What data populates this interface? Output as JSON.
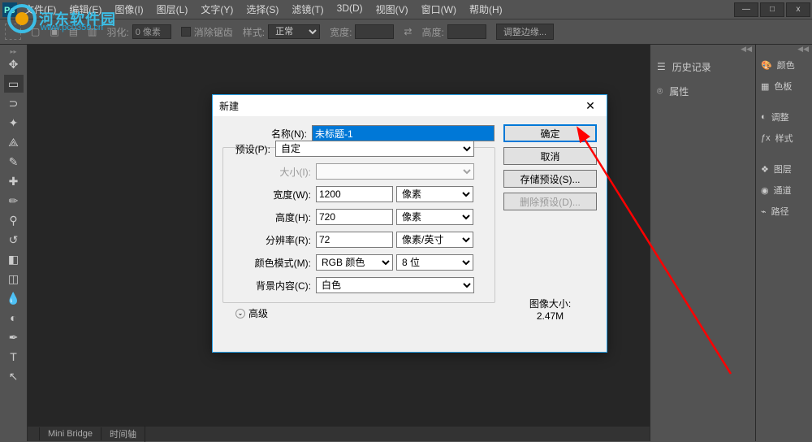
{
  "menubar": {
    "items": [
      "文件(F)",
      "编辑(E)",
      "图像(I)",
      "图层(L)",
      "文字(Y)",
      "选择(S)",
      "滤镜(T)",
      "3D(D)",
      "视图(V)",
      "窗口(W)",
      "帮助(H)"
    ]
  },
  "win_controls": {
    "min": "—",
    "max": "□",
    "close": "x"
  },
  "optbar": {
    "feather_label": "羽化:",
    "feather_value": "0 像素",
    "antialias": "消除锯齿",
    "style_label": "样式:",
    "style_value": "正常",
    "width_label": "宽度:",
    "height_label": "高度:",
    "refine": "调整边缘..."
  },
  "panels": {
    "history": "历史记录",
    "properties": "属性"
  },
  "side_panels": [
    "颜色",
    "色板",
    "调整",
    "样式",
    "图层",
    "通道",
    "路径"
  ],
  "bottom_tabs": [
    "Mini Bridge",
    "时间轴"
  ],
  "dialog": {
    "title": "新建",
    "name_label": "名称(N):",
    "name_value": "未标题-1",
    "preset_label": "预设(P):",
    "preset_value": "自定",
    "size_label": "大小(I):",
    "width_label": "宽度(W):",
    "width_value": "1200",
    "width_unit": "像素",
    "height_label": "高度(H):",
    "height_value": "720",
    "height_unit": "像素",
    "res_label": "分辨率(R):",
    "res_value": "72",
    "res_unit": "像素/英寸",
    "mode_label": "颜色模式(M):",
    "mode_value": "RGB 颜色",
    "depth_value": "8 位",
    "bg_label": "背景内容(C):",
    "bg_value": "白色",
    "advanced": "高级",
    "ok": "确定",
    "cancel": "取消",
    "save_preset": "存储预设(S)...",
    "delete_preset": "删除预设(D)...",
    "img_size_label": "图像大小:",
    "img_size_value": "2.47M"
  },
  "watermark": {
    "text": "河东软件园",
    "sub": "www.pc0359.cn"
  }
}
